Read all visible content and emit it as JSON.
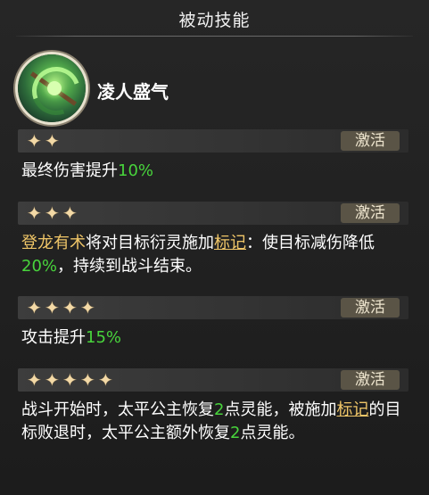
{
  "header": {
    "title": "被动技能"
  },
  "skill": {
    "name": "凌人盛气",
    "icon": "green-swirl-skill-icon"
  },
  "tiers": [
    {
      "stars": 2,
      "button": "激活",
      "text": [
        {
          "t": "最终伤害提升",
          "c": "w"
        },
        {
          "t": "10%",
          "c": "g"
        }
      ]
    },
    {
      "stars": 3,
      "button": "激活",
      "text": [
        {
          "t": "登龙有术",
          "c": "y"
        },
        {
          "t": "将对目标衍灵施加",
          "c": "w"
        },
        {
          "t": "标记",
          "c": "yu"
        },
        {
          "t": "：使目标减伤降低",
          "c": "w"
        },
        {
          "t": "20%",
          "c": "g"
        },
        {
          "t": "，持续到战斗结束。",
          "c": "w"
        }
      ]
    },
    {
      "stars": 4,
      "button": "激活",
      "text": [
        {
          "t": "攻击提升",
          "c": "w"
        },
        {
          "t": "15%",
          "c": "g"
        }
      ]
    },
    {
      "stars": 5,
      "button": "激活",
      "text": [
        {
          "t": "战斗开始时，太平公主恢复",
          "c": "w"
        },
        {
          "t": "2",
          "c": "g"
        },
        {
          "t": "点灵能，被施加",
          "c": "w"
        },
        {
          "t": "标记",
          "c": "yu"
        },
        {
          "t": "的目标败退时，太平公主额外恢复",
          "c": "w"
        },
        {
          "t": "2",
          "c": "g"
        },
        {
          "t": "点灵能。",
          "c": "w"
        }
      ]
    }
  ]
}
